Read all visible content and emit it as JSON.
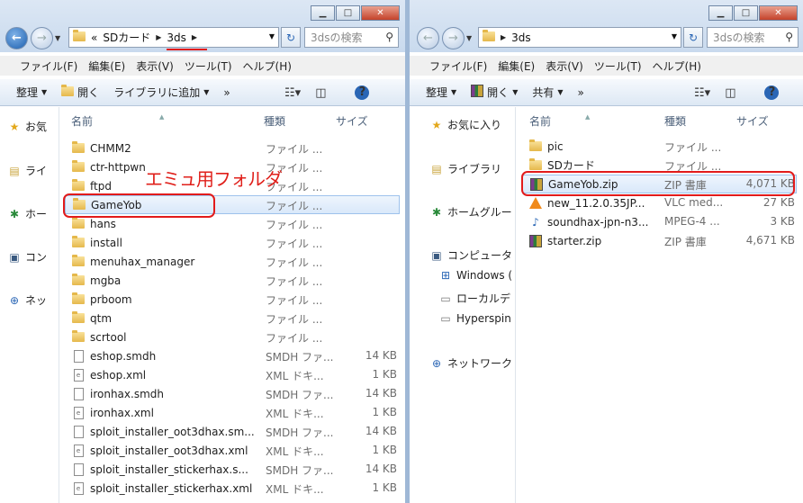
{
  "left": {
    "address": {
      "prefix": "«",
      "segments": [
        "SDカード",
        "3ds"
      ]
    },
    "search_placeholder": "3dsの検索",
    "menu": [
      "ファイル(F)",
      "編集(E)",
      "表示(V)",
      "ツール(T)",
      "ヘルプ(H)"
    ],
    "toolbar": {
      "organize": "整理",
      "open": "開く",
      "library": "ライブラリに追加",
      "more": "»"
    },
    "nav": [
      "お気",
      "ライ",
      "ホー",
      "コン",
      "ネッ"
    ],
    "columns": {
      "name": "名前",
      "type": "種類",
      "size": "サイズ"
    },
    "annotation": "エミュ用フォルダ",
    "files": [
      {
        "name": "CHMM2",
        "type": "ファイル ...",
        "size": "",
        "icon": "folder"
      },
      {
        "name": "ctr-httpwn",
        "type": "ファイル ...",
        "size": "",
        "icon": "folder"
      },
      {
        "name": "ftpd",
        "type": "ファイル ...",
        "size": "",
        "icon": "folder"
      },
      {
        "name": "GameYob",
        "type": "ファイル ...",
        "size": "",
        "icon": "folder"
      },
      {
        "name": "hans",
        "type": "ファイル ...",
        "size": "",
        "icon": "folder"
      },
      {
        "name": "install",
        "type": "ファイル ...",
        "size": "",
        "icon": "folder"
      },
      {
        "name": "menuhax_manager",
        "type": "ファイル ...",
        "size": "",
        "icon": "folder"
      },
      {
        "name": "mgba",
        "type": "ファイル ...",
        "size": "",
        "icon": "folder"
      },
      {
        "name": "prboom",
        "type": "ファイル ...",
        "size": "",
        "icon": "folder"
      },
      {
        "name": "qtm",
        "type": "ファイル ...",
        "size": "",
        "icon": "folder"
      },
      {
        "name": "scrtool",
        "type": "ファイル ...",
        "size": "",
        "icon": "folder"
      },
      {
        "name": "eshop.smdh",
        "type": "SMDH ファ...",
        "size": "14 KB",
        "icon": "file"
      },
      {
        "name": "eshop.xml",
        "type": "XML ドキ...",
        "size": "1 KB",
        "icon": "xml"
      },
      {
        "name": "ironhax.smdh",
        "type": "SMDH ファ...",
        "size": "14 KB",
        "icon": "file"
      },
      {
        "name": "ironhax.xml",
        "type": "XML ドキ...",
        "size": "1 KB",
        "icon": "xml"
      },
      {
        "name": "sploit_installer_oot3dhax.sm...",
        "type": "SMDH ファ...",
        "size": "14 KB",
        "icon": "file"
      },
      {
        "name": "sploit_installer_oot3dhax.xml",
        "type": "XML ドキ...",
        "size": "1 KB",
        "icon": "xml"
      },
      {
        "name": "sploit_installer_stickerhax.s...",
        "type": "SMDH ファ...",
        "size": "14 KB",
        "icon": "file"
      },
      {
        "name": "sploit_installer_stickerhax.xml",
        "type": "XML ドキ...",
        "size": "1 KB",
        "icon": "xml"
      }
    ]
  },
  "right": {
    "address": {
      "segments": [
        "3ds"
      ]
    },
    "search_placeholder": "3dsの検索",
    "menu": [
      "ファイル(F)",
      "編集(E)",
      "表示(V)",
      "ツール(T)",
      "ヘルプ(H)"
    ],
    "toolbar": {
      "organize": "整理",
      "open": "開く",
      "share": "共有",
      "more": "»"
    },
    "nav": [
      "お気に入り",
      "ライブラリ",
      "ホームグルー",
      "コンピュータ",
      "Windows (",
      "ローカルデ",
      "Hyperspin",
      "ネットワーク"
    ],
    "columns": {
      "name": "名前",
      "type": "種類",
      "size": "サイズ"
    },
    "files": [
      {
        "name": "pic",
        "type": "ファイル ...",
        "size": "",
        "icon": "folder"
      },
      {
        "name": "SDカード",
        "type": "ファイル ...",
        "size": "",
        "icon": "folder"
      },
      {
        "name": "GameYob.zip",
        "type": "ZIP 書庫",
        "size": "4,071 KB",
        "icon": "zip"
      },
      {
        "name": "new_11.2.0.35JP...",
        "type": "VLC med...",
        "size": "27 KB",
        "icon": "vlc"
      },
      {
        "name": "soundhax-jpn-n3...",
        "type": "MPEG-4 ...",
        "size": "3 KB",
        "icon": "audio"
      },
      {
        "name": "starter.zip",
        "type": "ZIP 書庫",
        "size": "4,671 KB",
        "icon": "zip"
      }
    ]
  }
}
